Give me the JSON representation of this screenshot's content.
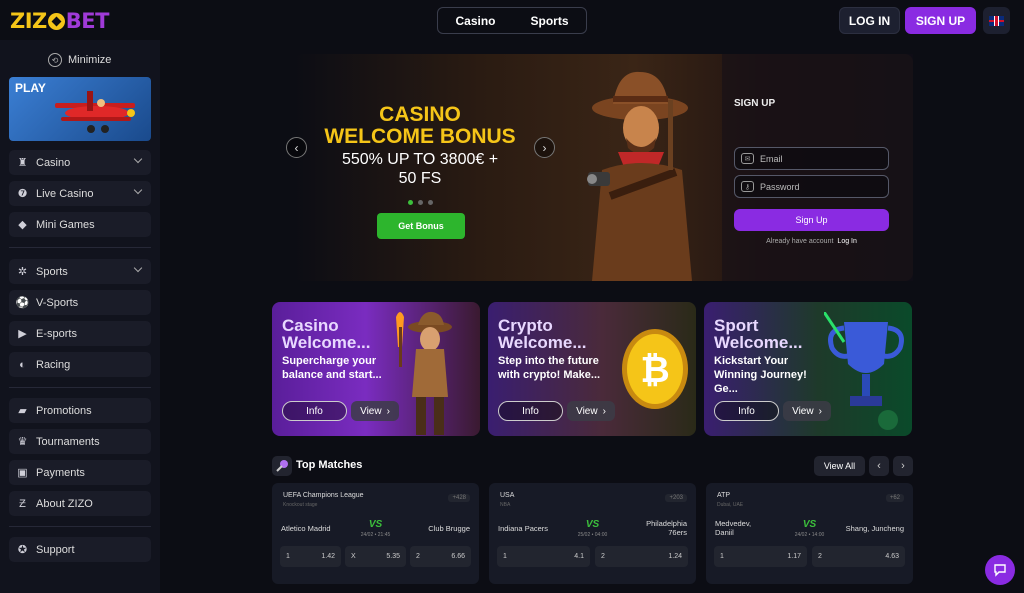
{
  "header": {
    "logo_zizo": "ZIZ",
    "logo_bet": "BET",
    "nav": [
      "Casino",
      "Sports"
    ],
    "login": "LOG IN",
    "signup": "SIGN UP"
  },
  "sidebar": {
    "minimize": "Minimize",
    "play_letters": "PLAY",
    "items": [
      {
        "label": "Casino",
        "icon": "slot-machine-icon"
      },
      {
        "label": "Live Casino",
        "icon": "live-casino-icon"
      },
      {
        "label": "Mini Games",
        "icon": "diamond-icon"
      },
      {
        "label": "Sports",
        "icon": "gear-icon"
      },
      {
        "label": "V-Sports",
        "icon": "vsports-icon"
      },
      {
        "label": "E-sports",
        "icon": "play-icon"
      },
      {
        "label": "Racing",
        "icon": "racing-icon"
      },
      {
        "label": "Promotions",
        "icon": "promotions-icon"
      },
      {
        "label": "Tournaments",
        "icon": "trophy-icon"
      },
      {
        "label": "Payments",
        "icon": "wallet-icon"
      },
      {
        "label": "About ZIZO",
        "icon": "zizo-icon"
      },
      {
        "label": "Support",
        "icon": "support-icon"
      }
    ]
  },
  "hero": {
    "title_line1": "CASINO",
    "title_line2": "WELCOME BONUS",
    "subtitle_line1": "550% UP TO 3800€ +",
    "subtitle_line2": "50 FS",
    "button": "Get Bonus"
  },
  "signup_form": {
    "title": "SIGN UP",
    "email_placeholder": "Email",
    "password_placeholder": "Password",
    "button": "Sign Up",
    "already": "Already have account",
    "login_link": "Log In"
  },
  "promos": [
    {
      "title_line1": "Casino",
      "title_line2": "Welcome...",
      "desc_line1": "Supercharge your",
      "desc_line2": "balance and start...",
      "info": "Info",
      "view": "View"
    },
    {
      "title_line1": "Crypto",
      "title_line2": "Welcome...",
      "desc_line1": "Step into the future",
      "desc_line2": "with crypto!  Make...",
      "info": "Info",
      "view": "View"
    },
    {
      "title_line1": "Sport",
      "title_line2": "Welcome...",
      "desc_line1": "Kickstart Your",
      "desc_line2": "Winning Journey! Ge...",
      "info": "Info",
      "view": "View"
    }
  ],
  "top_matches": {
    "title": "Top Matches",
    "view_all": "View All",
    "matches": [
      {
        "league": "UEFA Champions League",
        "sub": "Knockout stage",
        "count": "+428",
        "home": "Atletico Madrid",
        "away": "Club Brugge",
        "vs": "VS",
        "time": "24/02 • 21:45",
        "odds": [
          {
            "label": "1",
            "value": "1.42"
          },
          {
            "label": "X",
            "value": "5.35"
          },
          {
            "label": "2",
            "value": "6.66"
          }
        ]
      },
      {
        "league": "USA",
        "sub": "NBA",
        "count": "+203",
        "home": "Indiana Pacers",
        "away_line1": "Philadelphia",
        "away_line2": "76ers",
        "vs": "VS",
        "time": "25/02 • 04:00",
        "odds": [
          {
            "label": "1",
            "value": "4.1"
          },
          {
            "label": "2",
            "value": "1.24"
          }
        ]
      },
      {
        "league": "ATP",
        "sub": "Dubai, UAE",
        "count": "+62",
        "home_line1": "Medvedev,",
        "home_line2": "Daniil",
        "away": "Shang, Juncheng",
        "vs": "VS",
        "time": "24/02 • 14:00",
        "odds": [
          {
            "label": "1",
            "value": "1.17"
          },
          {
            "label": "2",
            "value": "4.63"
          }
        ]
      }
    ]
  },
  "colors": {
    "accent": "#8a2be2",
    "gold": "#f5c518",
    "green": "#2db52d"
  }
}
